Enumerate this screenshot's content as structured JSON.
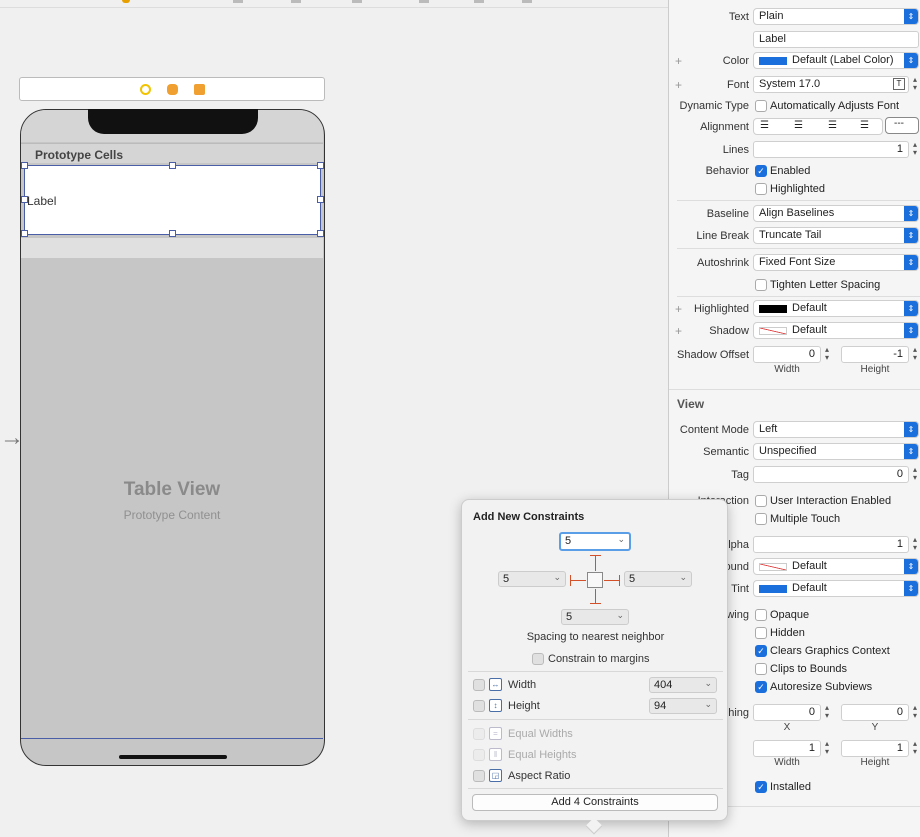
{
  "canvas": {
    "prototype_cells_title": "Prototype Cells",
    "cell_label": "Label",
    "table_view_title": "Table View",
    "table_view_subtitle": "Prototype Content"
  },
  "inspector": {
    "text_label": "Text",
    "text_value": "Plain",
    "label_text_value": "Label",
    "color_label": "Color",
    "color_value": "Default (Label Color)",
    "font_label": "Font",
    "font_value": "System 17.0",
    "dynamic_type_label": "Dynamic Type",
    "dynamic_type_checkbox": "Automatically Adjusts Font",
    "alignment_label": "Alignment",
    "lines_label": "Lines",
    "lines_value": "1",
    "behavior_label": "Behavior",
    "enabled_label": "Enabled",
    "highlighted_cb_label": "Highlighted",
    "baseline_label": "Baseline",
    "baseline_value": "Align Baselines",
    "line_break_label": "Line Break",
    "line_break_value": "Truncate Tail",
    "autoshrink_label": "Autoshrink",
    "autoshrink_value": "Fixed Font Size",
    "tighten_label": "Tighten Letter Spacing",
    "highlighted_label": "Highlighted",
    "highlighted_value": "Default",
    "shadow_label": "Shadow",
    "shadow_value": "Default",
    "shadow_offset_label": "Shadow Offset",
    "shadow_offset_width": "0",
    "shadow_offset_height": "-1",
    "width_label": "Width",
    "height_label": "Height",
    "view_section": "View",
    "content_mode_label": "Content Mode",
    "content_mode_value": "Left",
    "semantic_label": "Semantic",
    "semantic_value": "Unspecified",
    "tag_label": "Tag",
    "tag_value": "0",
    "interaction_label": "Interaction",
    "user_interaction_label": "User Interaction Enabled",
    "multiple_touch_label": "Multiple Touch",
    "alpha_label": "Alpha",
    "alpha_value": "1",
    "background_label": "Background",
    "background_value": "Default",
    "tint_label": "Tint",
    "tint_value": "Default",
    "drawing_label": "Drawing",
    "opaque_label": "Opaque",
    "hidden_label": "Hidden",
    "clears_label": "Clears Graphics Context",
    "clips_label": "Clips to Bounds",
    "autoresize_label": "Autoresize Subviews",
    "stretching_label": "Stretching",
    "stretch_x": "0",
    "stretch_y": "0",
    "x_label": "X",
    "y_label": "Y",
    "stretch_w": "1",
    "stretch_h": "1",
    "installed_label": "Installed",
    "color_swatch": "#1a6fdc",
    "highlight_swatch": "#000000"
  },
  "popover": {
    "title": "Add New Constraints",
    "top_value": "5",
    "left_value": "5",
    "right_value": "5",
    "bottom_value": "5",
    "spacing_label": "Spacing to nearest neighbor",
    "constrain_margins": "Constrain to margins",
    "width_label": "Width",
    "width_value": "404",
    "height_label": "Height",
    "height_value": "94",
    "equal_widths": "Equal Widths",
    "equal_heights": "Equal Heights",
    "aspect_ratio": "Aspect Ratio",
    "add_button": "Add 4 Constraints"
  }
}
